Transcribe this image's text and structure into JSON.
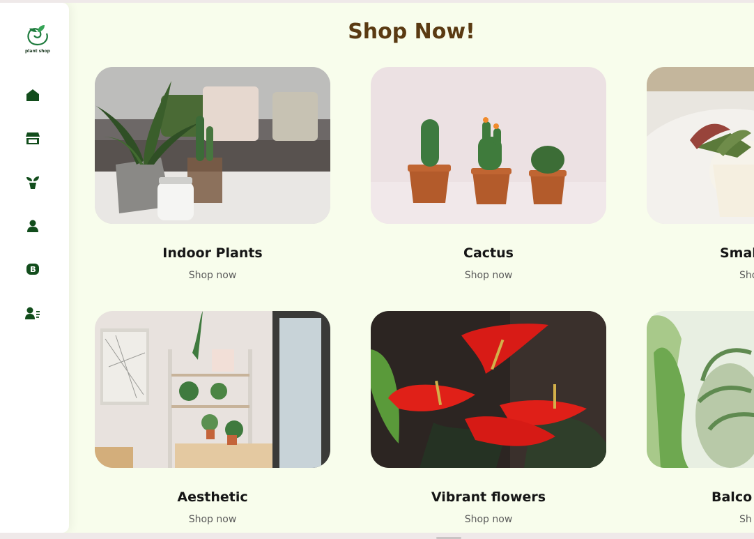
{
  "sidebar": {
    "logo_text": "plant shop",
    "items": [
      {
        "icon": "home-icon"
      },
      {
        "icon": "store-icon"
      },
      {
        "icon": "plant-icon"
      },
      {
        "icon": "user-icon"
      },
      {
        "icon": "blog-icon"
      },
      {
        "icon": "user-list-icon"
      }
    ]
  },
  "header": {
    "title": "Shop Now!"
  },
  "categories": [
    {
      "name": "Indoor Plants",
      "link": "Shop now"
    },
    {
      "name": "Cactus",
      "link": "Shop now"
    },
    {
      "name": "Smal",
      "link": "Sho"
    },
    {
      "name": "Aesthetic",
      "link": "Shop now"
    },
    {
      "name": "Vibrant flowers",
      "link": "Shop now"
    },
    {
      "name": "Balco",
      "link": "Sh"
    }
  ],
  "colors": {
    "background": "#f8fdec",
    "accent": "#124d1c",
    "title": "#5a3a12"
  }
}
